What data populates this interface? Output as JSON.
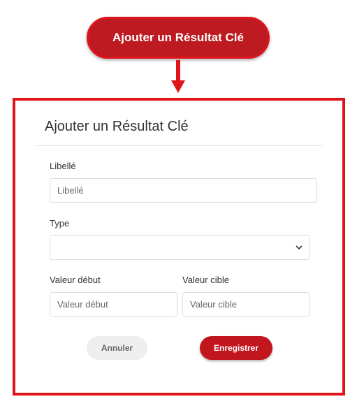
{
  "trigger_button": {
    "label": "Ajouter un Résultat Clé"
  },
  "modal": {
    "title": "Ajouter un Résultat Clé",
    "libelle": {
      "label": "Libellé",
      "placeholder": "Libellé",
      "value": ""
    },
    "type": {
      "label": "Type",
      "selected": ""
    },
    "valeur_debut": {
      "label": "Valeur début",
      "placeholder": "Valeur début",
      "value": ""
    },
    "valeur_cible": {
      "label": "Valeur cible",
      "placeholder": "Valeur cible",
      "value": ""
    },
    "cancel_label": "Annuler",
    "save_label": "Enregistrer"
  },
  "icons": {
    "arrow": "arrow-down-icon",
    "select_caret": "chevron-down-icon"
  },
  "colors": {
    "brand_red": "#c2161e",
    "highlight_red": "#e0141b",
    "cancel_bg": "#eeeeee",
    "border": "#dcdcdc"
  }
}
